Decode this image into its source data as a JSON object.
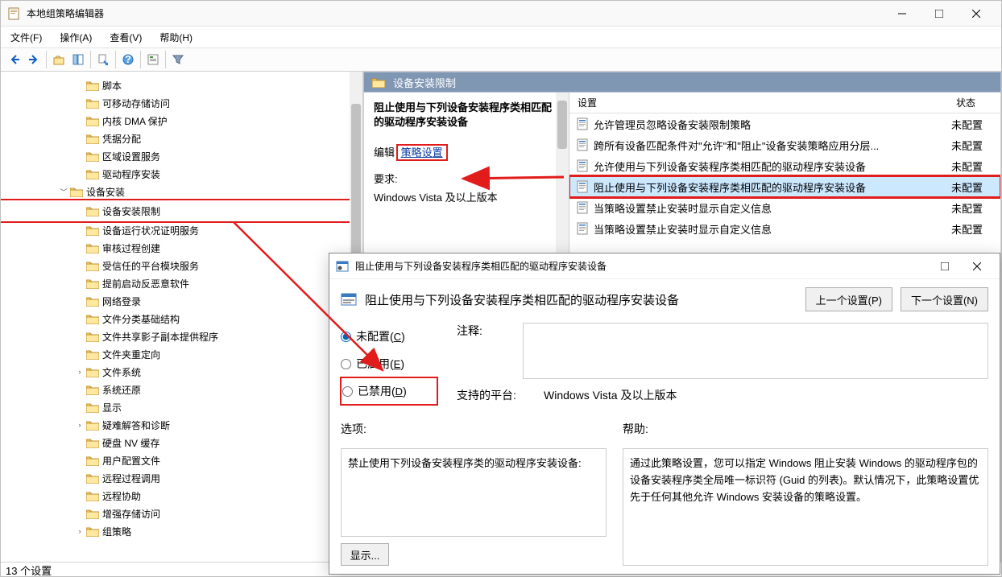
{
  "window": {
    "title": "本地组策略编辑器"
  },
  "menubar": {
    "file": "文件(F)",
    "action": "操作(A)",
    "view": "查看(V)",
    "help": "帮助(H)"
  },
  "tree": [
    {
      "indent": 4,
      "label": "脚本",
      "expand": ""
    },
    {
      "indent": 4,
      "label": "可移动存储访问",
      "expand": ""
    },
    {
      "indent": 4,
      "label": "内核 DMA 保护",
      "expand": ""
    },
    {
      "indent": 4,
      "label": "凭据分配",
      "expand": ""
    },
    {
      "indent": 4,
      "label": "区域设置服务",
      "expand": ""
    },
    {
      "indent": 4,
      "label": "驱动程序安装",
      "expand": ""
    },
    {
      "indent": 3,
      "label": "设备安装",
      "expand": "v"
    },
    {
      "indent": 4,
      "label": "设备安装限制",
      "expand": "",
      "highlight": true
    },
    {
      "indent": 4,
      "label": "设备运行状况证明服务",
      "expand": ""
    },
    {
      "indent": 4,
      "label": "审核过程创建",
      "expand": ""
    },
    {
      "indent": 4,
      "label": "受信任的平台模块服务",
      "expand": ""
    },
    {
      "indent": 4,
      "label": "提前启动反恶意软件",
      "expand": ""
    },
    {
      "indent": 4,
      "label": "网络登录",
      "expand": ""
    },
    {
      "indent": 4,
      "label": "文件分类基础结构",
      "expand": ""
    },
    {
      "indent": 4,
      "label": "文件共享影子副本提供程序",
      "expand": ""
    },
    {
      "indent": 4,
      "label": "文件夹重定向",
      "expand": ""
    },
    {
      "indent": 4,
      "label": "文件系统",
      "expand": ">"
    },
    {
      "indent": 4,
      "label": "系统还原",
      "expand": ""
    },
    {
      "indent": 4,
      "label": "显示",
      "expand": ""
    },
    {
      "indent": 4,
      "label": "疑难解答和诊断",
      "expand": ">"
    },
    {
      "indent": 4,
      "label": "硬盘 NV 缓存",
      "expand": ""
    },
    {
      "indent": 4,
      "label": "用户配置文件",
      "expand": ""
    },
    {
      "indent": 4,
      "label": "远程过程调用",
      "expand": ""
    },
    {
      "indent": 4,
      "label": "远程协助",
      "expand": ""
    },
    {
      "indent": 4,
      "label": "增强存储访问",
      "expand": ""
    },
    {
      "indent": 4,
      "label": "组策略",
      "expand": ">"
    }
  ],
  "right": {
    "header": "设备安装限制",
    "desc_title": "阻止使用与下列设备安装程序类相匹配的驱动程序安装设备",
    "edit_label": "编辑",
    "edit_link": "策略设置",
    "req_label": "要求:",
    "req_value": "Windows Vista 及以上版本",
    "col_setting": "设置",
    "col_state": "状态",
    "rows": [
      {
        "text": "允许管理员忽略设备安装限制策略",
        "state": "未配置"
      },
      {
        "text": "跨所有设备匹配条件对\"允许\"和\"阻止\"设备安装策略应用分层...",
        "state": "未配置"
      },
      {
        "text": "允许使用与下列设备安装程序类相匹配的驱动程序安装设备",
        "state": "未配置"
      },
      {
        "text": "阻止使用与下列设备安装程序类相匹配的驱动程序安装设备",
        "state": "未配置",
        "selected": true,
        "highlight": true
      },
      {
        "text": "当策略设置禁止安装时显示自定义信息",
        "state": "未配置"
      },
      {
        "text": "当策略设置禁止安装时显示自定义信息",
        "state": "未配置"
      }
    ]
  },
  "statusbar": "13 个设置",
  "dialog": {
    "title": "阻止使用与下列设备安装程序类相匹配的驱动程序安装设备",
    "header_title": "阻止使用与下列设备安装程序类相匹配的驱动程序安装设备",
    "prev_btn": "上一个设置(P)",
    "next_btn": "下一个设置(N)",
    "radio_unconf": "未配置(C)",
    "radio_enabled": "已启用(E)",
    "radio_disabled": "已禁用(D)",
    "comment_label": "注释:",
    "platform_label": "支持的平台:",
    "platform_value": "Windows Vista 及以上版本",
    "options_label": "选项:",
    "options_text": "禁止使用下列设备安装程序类的驱动程序安装设备:",
    "show_btn": "显示...",
    "help_label": "帮助:",
    "help_text": "通过此策略设置，您可以指定 Windows 阻止安装 Windows 的驱动程序包的设备安装程序类全局唯一标识符 (Guid 的列表)。默认情况下，此策略设置优先于任何其他允许 Windows 安装设备的策略设置。"
  }
}
